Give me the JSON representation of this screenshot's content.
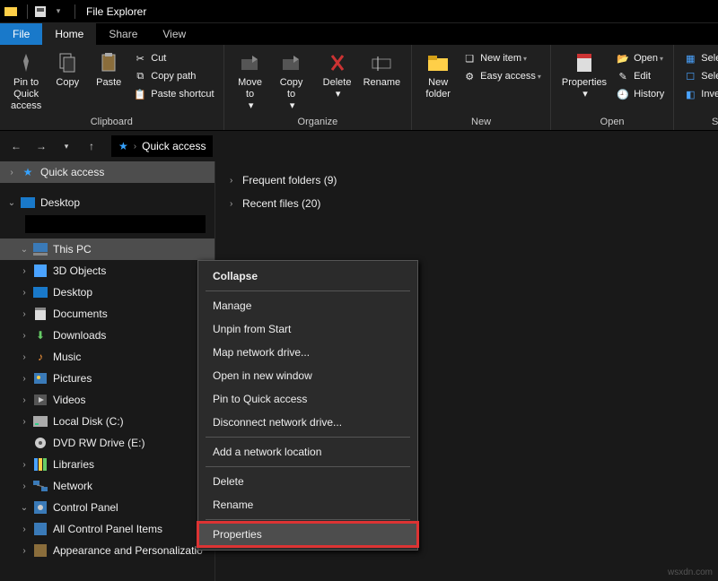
{
  "titlebar": {
    "title": "File Explorer"
  },
  "tabs": {
    "file": "File",
    "home": "Home",
    "share": "Share",
    "view": "View"
  },
  "ribbon": {
    "clipboard": {
      "label": "Clipboard",
      "pin": "Pin to Quick\naccess",
      "copy": "Copy",
      "paste": "Paste",
      "cut": "Cut",
      "copy_path": "Copy path",
      "paste_shortcut": "Paste shortcut"
    },
    "organize": {
      "label": "Organize",
      "move_to": "Move\nto",
      "copy_to": "Copy\nto",
      "delete": "Delete",
      "rename": "Rename"
    },
    "new": {
      "label": "New",
      "new_folder": "New\nfolder",
      "new_item": "New item",
      "easy_access": "Easy access"
    },
    "open": {
      "label": "Open",
      "properties": "Properties",
      "open": "Open",
      "edit": "Edit",
      "history": "History"
    },
    "select": {
      "label": "Select",
      "select_all": "Select all",
      "select_none": "Select none",
      "invert": "Invert selection"
    }
  },
  "address": {
    "location": "Quick access"
  },
  "sidebar": {
    "quick_access": "Quick access",
    "desktop": "Desktop",
    "this_pc": "This PC",
    "items": {
      "objects3d": "3D Objects",
      "desktop": "Desktop",
      "documents": "Documents",
      "downloads": "Downloads",
      "music": "Music",
      "pictures": "Pictures",
      "videos": "Videos",
      "local_disk": "Local Disk (C:)",
      "dvd": "DVD RW Drive (E:)"
    },
    "libraries": "Libraries",
    "network": "Network",
    "control_panel": "Control Panel",
    "cp_items": {
      "all": "All Control Panel Items",
      "appearance": "Appearance and Personalizatio"
    }
  },
  "content": {
    "frequent": "Frequent folders (9)",
    "recent": "Recent files (20)"
  },
  "context_menu": {
    "collapse": "Collapse",
    "manage": "Manage",
    "unpin": "Unpin from Start",
    "map_drive": "Map network drive...",
    "open_new": "Open in new window",
    "pin_qa": "Pin to Quick access",
    "disconnect": "Disconnect network drive...",
    "add_loc": "Add a network location",
    "delete": "Delete",
    "rename": "Rename",
    "properties": "Properties"
  },
  "watermark": "wsxdn.com"
}
